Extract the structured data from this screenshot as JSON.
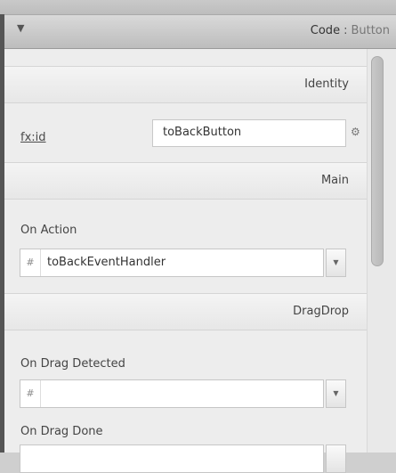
{
  "header": {
    "collapse_glyph": "▼",
    "section_name": "Code",
    "separator": ":",
    "component_type": "Button"
  },
  "identity": {
    "title": "Identity",
    "fx_id_label": "fx:id",
    "fx_id_value": "toBackButton",
    "gear_icon": "gear-icon"
  },
  "main": {
    "title": "Main",
    "on_action_label": "On Action",
    "on_action_prefix": "#",
    "on_action_value": "toBackEventHandler",
    "dropdown_glyph": "▼"
  },
  "dragdrop": {
    "title": "DragDrop",
    "on_drag_detected_label": "On Drag Detected",
    "on_drag_detected_prefix": "#",
    "on_drag_detected_value": "",
    "on_drag_done_label": "On Drag Done",
    "dropdown_glyph": "▼"
  }
}
